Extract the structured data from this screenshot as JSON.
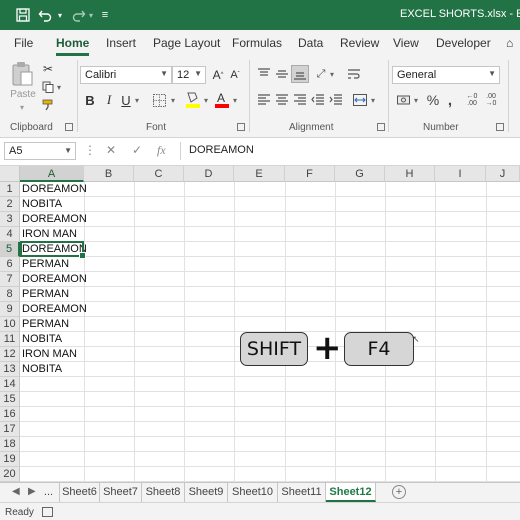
{
  "titlebar": {
    "title": "EXCEL SHORTS.xlsx  -  Exce"
  },
  "tabs": [
    "File",
    "Home",
    "Insert",
    "Page Layout",
    "Formulas",
    "Data",
    "Review",
    "View",
    "Developer"
  ],
  "ribbon": {
    "clipboard": {
      "paste_label": "Paste",
      "group_label": "Clipboard"
    },
    "font": {
      "name": "Calibri",
      "size": "12",
      "group_label": "Font"
    },
    "alignment": {
      "group_label": "Alignment"
    },
    "number": {
      "format": "General",
      "group_label": "Number"
    }
  },
  "formula_bar": {
    "name_box": "A5",
    "fx": "fx",
    "value": "DOREAMON"
  },
  "grid": {
    "columns": [
      "A",
      "B",
      "C",
      "D",
      "E",
      "F",
      "G",
      "H",
      "I",
      "J"
    ],
    "rows": [
      "1",
      "2",
      "3",
      "4",
      "5",
      "6",
      "7",
      "8",
      "9",
      "10",
      "11",
      "12",
      "13",
      "14",
      "15",
      "16",
      "17",
      "18",
      "19",
      "20"
    ],
    "column_a": [
      "DOREAMON",
      "NOBITA",
      "DOREAMON",
      "IRON MAN",
      "DOREAMON",
      "PERMAN",
      "DOREAMON",
      "PERMAN",
      "DOREAMON",
      "PERMAN",
      "NOBITA",
      "IRON MAN",
      "NOBITA"
    ],
    "selected_cell": "A5"
  },
  "overlay": {
    "key1": "SHIFT",
    "plus": "+",
    "key2": "F4"
  },
  "sheets": {
    "nav_more": "...",
    "names": [
      "Sheet6",
      "Sheet7",
      "Sheet8",
      "Sheet9",
      "Sheet10",
      "Sheet11",
      "Sheet12"
    ],
    "active": "Sheet12"
  },
  "status": {
    "text": "Ready"
  },
  "colors": {
    "accent": "#217346",
    "ribbon_bg": "#f3f3f3"
  }
}
